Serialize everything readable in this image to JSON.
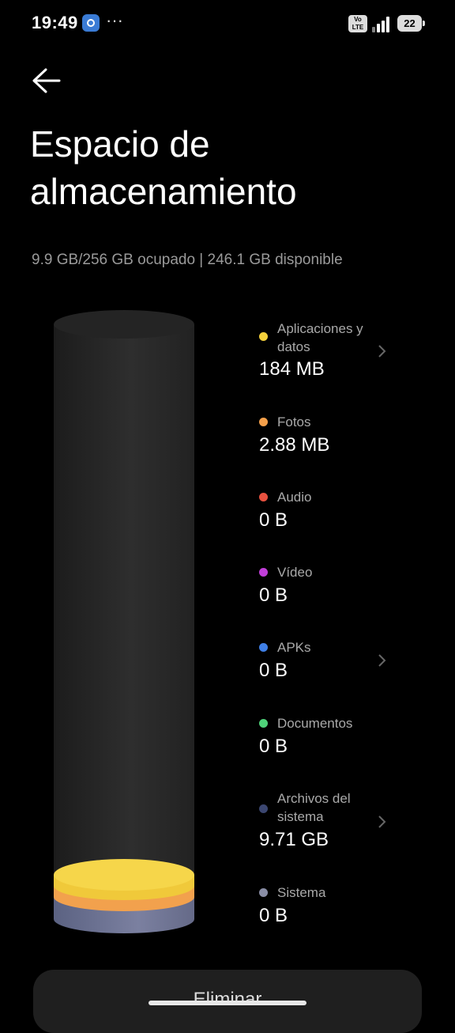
{
  "status_bar": {
    "time": "19:49",
    "volte_line1": "Vo",
    "volte_line2": "LTE",
    "battery": "22",
    "overflow": "···"
  },
  "header": {
    "title": "Espacio de almacenamiento"
  },
  "summary": "9.9 GB/256 GB ocupado | 246.1 GB disponible",
  "categories": [
    {
      "label": "Aplicaciones y datos",
      "value": "184 MB",
      "color": "#f5d13b",
      "has_chevron": true
    },
    {
      "label": "Fotos",
      "value": "2.88 MB",
      "color": "#f5a04b",
      "has_chevron": false
    },
    {
      "label": "Audio",
      "value": "0 B",
      "color": "#e8513f",
      "has_chevron": false
    },
    {
      "label": "Vídeo",
      "value": "0 B",
      "color": "#c13ed9",
      "has_chevron": false
    },
    {
      "label": "APKs",
      "value": "0 B",
      "color": "#3f7fe6",
      "has_chevron": true
    },
    {
      "label": "Documentos",
      "value": "0 B",
      "color": "#4fd37a",
      "has_chevron": false
    },
    {
      "label": "Archivos del sistema",
      "value": "9.71 GB",
      "color": "#3b4670",
      "has_chevron": true
    },
    {
      "label": "Sistema",
      "value": "0 B",
      "color": "#8a8ea6",
      "has_chevron": false
    }
  ],
  "storage": {
    "used_gb": 9.9,
    "total_gb": 256,
    "available_gb": 246.1
  },
  "actions": {
    "clean_label": "Eliminar"
  },
  "colors": {
    "background": "#000000",
    "cylinder": "#2a2a2a",
    "button": "#1f1f1f"
  }
}
